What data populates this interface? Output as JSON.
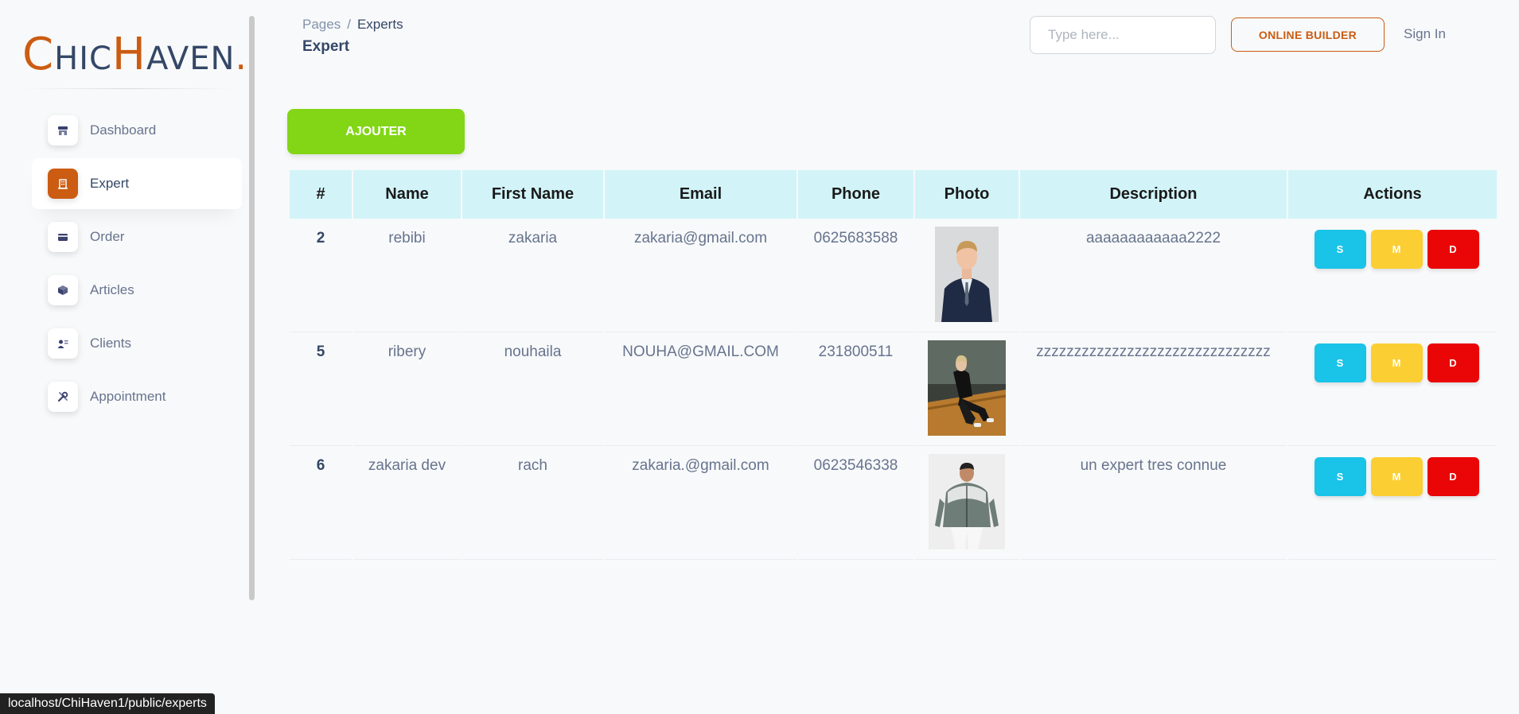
{
  "brand": {
    "initial1": "C",
    "rest1": "HIC",
    "initial2": "H",
    "rest2": "AVEN",
    "dot": ".",
    "accent_color": "#cb5c12"
  },
  "sidebar": {
    "items": [
      {
        "label": "Dashboard",
        "icon": "shop-icon",
        "active": false
      },
      {
        "label": "Expert",
        "icon": "office-icon",
        "active": true
      },
      {
        "label": "Order",
        "icon": "credit-card-icon",
        "active": false
      },
      {
        "label": "Articles",
        "icon": "box-3d-icon",
        "active": false
      },
      {
        "label": "Clients",
        "icon": "user-badge-icon",
        "active": false
      },
      {
        "label": "Appointment",
        "icon": "tools-icon",
        "active": false
      }
    ]
  },
  "header": {
    "breadcrumb_parent": "Pages",
    "breadcrumb_sep": "/",
    "breadcrumb_current": "Experts",
    "page_title": "Expert",
    "search_placeholder": "Type here...",
    "builder_label": "ONLINE BUILDER",
    "sign_in_label": "Sign In"
  },
  "main": {
    "add_label": "AJOUTER",
    "add_color": "#82d616"
  },
  "table": {
    "columns": [
      "#",
      "Name",
      "First Name",
      "Email",
      "Phone",
      "Photo",
      "Description",
      "Actions"
    ],
    "rows": [
      {
        "id": "2",
        "name": "rebibi",
        "first_name": "zakaria",
        "email": "zakaria@gmail.com",
        "phone": "0625683588",
        "photo": "man-in-suit-photo",
        "description": "aaaaaaaaaaaa2222"
      },
      {
        "id": "5",
        "name": "ribery",
        "first_name": "nouhaila",
        "email": "NOUHA@GMAIL.COM",
        "phone": "231800511",
        "photo": "woman-tracksuit-photo",
        "description": "zzzzzzzzzzzzzzzzzzzzzzzzzzzzzzz"
      },
      {
        "id": "6",
        "name": "zakaria dev",
        "first_name": "rach",
        "email": "zakaria.@gmail.com",
        "phone": "0623546338",
        "photo": "man-windbreaker-photo",
        "description": "un expert tres connue"
      }
    ],
    "actions": {
      "show": "S",
      "modify": "M",
      "delete": "D"
    },
    "header_bg": "#d2f4f9"
  },
  "status_bar": {
    "url": "localhost/ChiHaven1/public/experts"
  }
}
